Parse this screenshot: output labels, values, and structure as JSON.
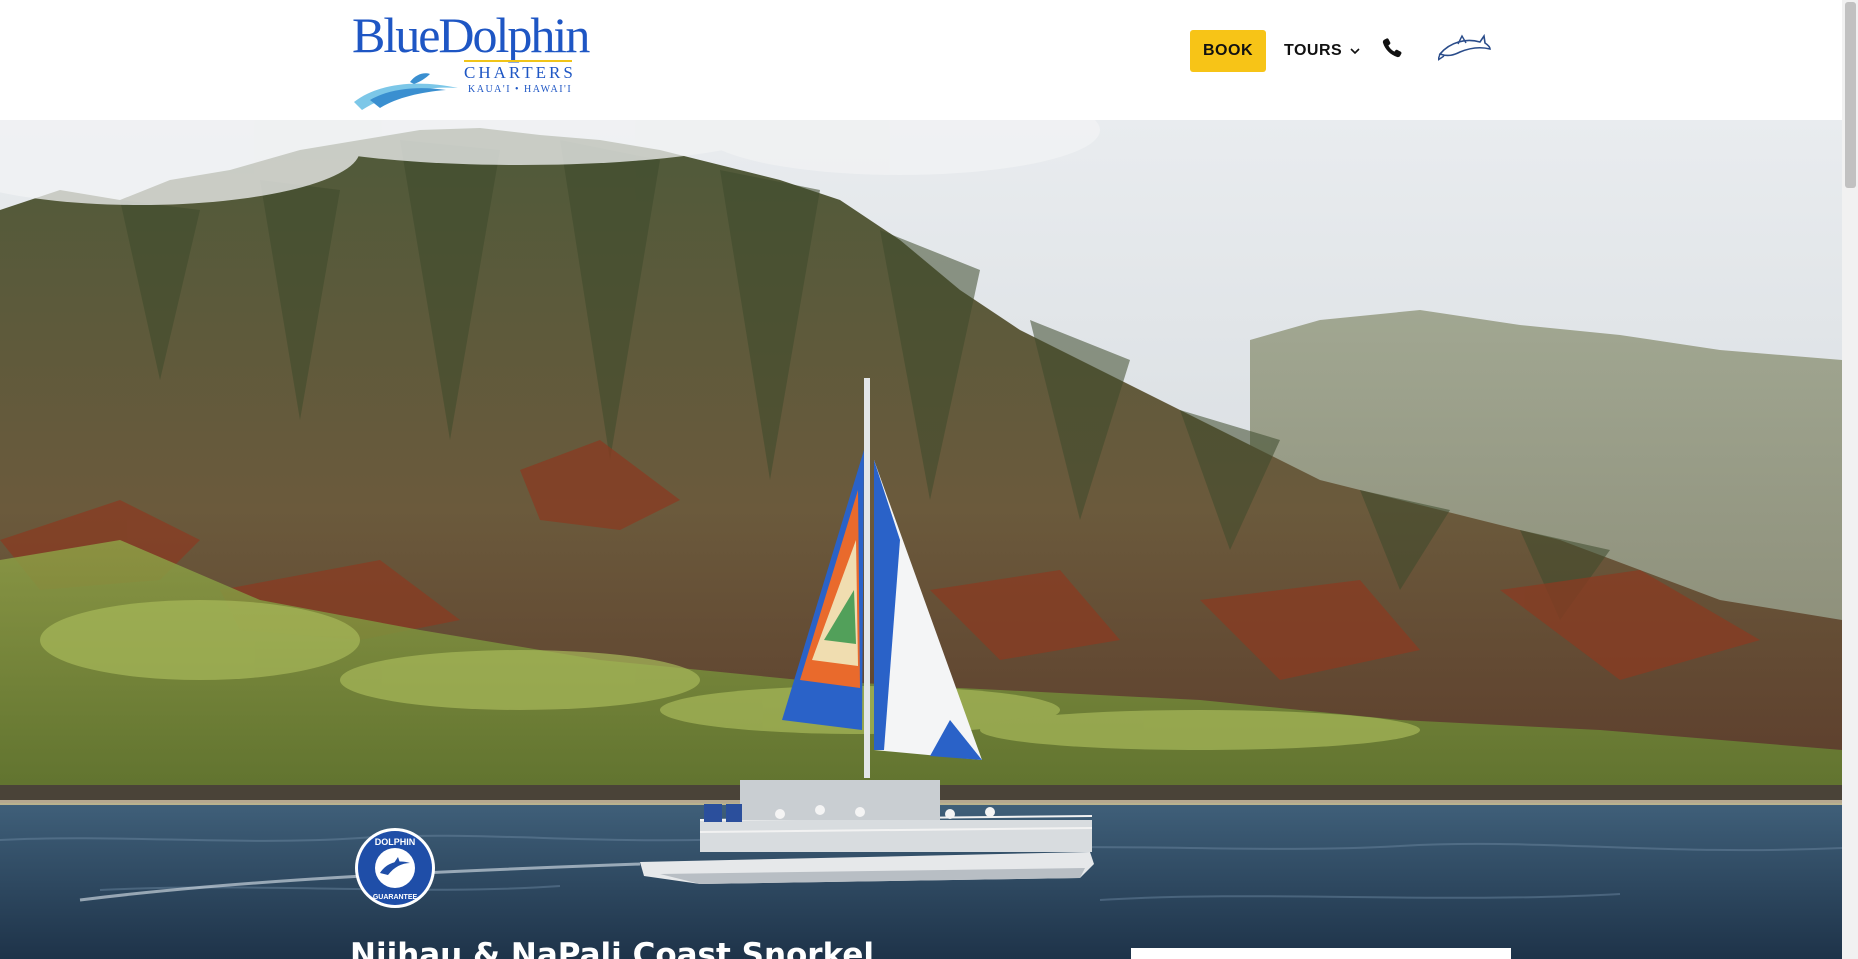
{
  "brand": {
    "name": "BlueDolphin",
    "sub": "CHARTERS",
    "location": "KAUA'I • HAWAI'I",
    "colors": {
      "blue": "#1e56c4",
      "gold": "#f0c419"
    }
  },
  "nav": {
    "book_label": "BOOK",
    "tours_label": "TOURS",
    "tours_icon": "chevron-down-icon",
    "phone_icon": "phone-icon",
    "dolphin_icon": "dolphin-icon"
  },
  "hero": {
    "badge_top": "DOLPHIN",
    "badge_bottom": "GUARANTEE",
    "heading": "Niihau & NaPali Coast Snorkel"
  },
  "colors": {
    "accent": "#f7c417",
    "ocean": "#2b4560",
    "text": "#111111"
  }
}
